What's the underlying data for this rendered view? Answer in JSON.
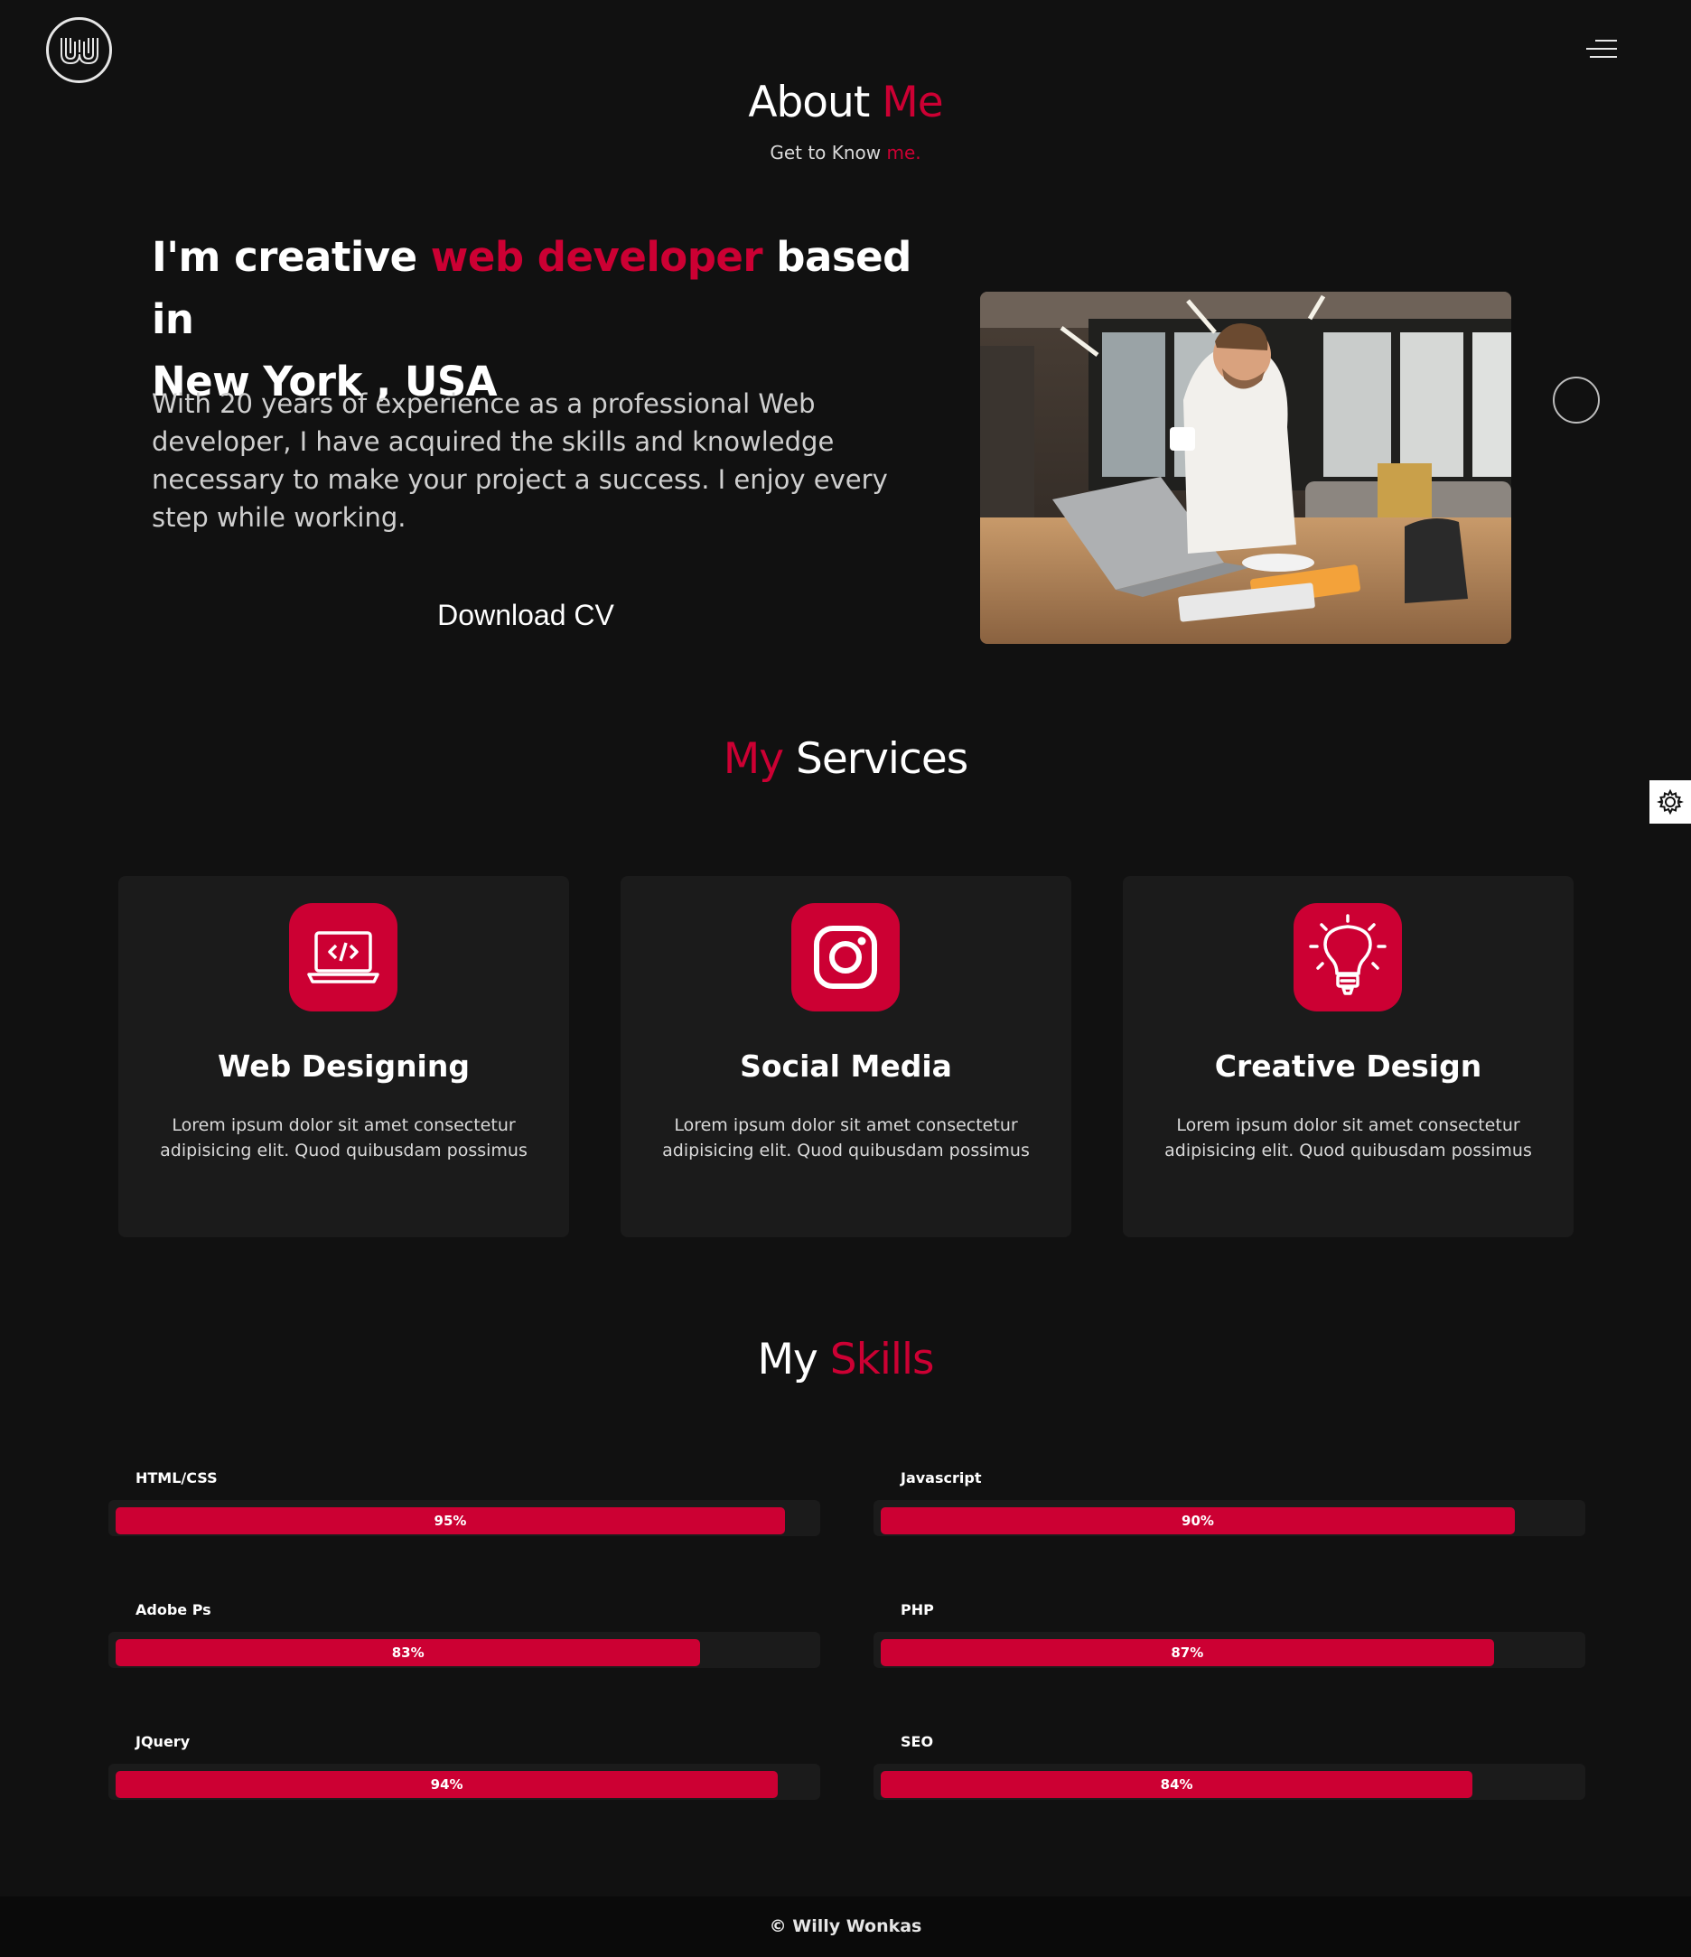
{
  "header": {
    "logo_icon": "w-logo-icon",
    "menu_icon": "hamburger-menu-icon"
  },
  "about": {
    "title_part1": "About ",
    "title_part2": "Me",
    "subtitle_part1": "Get to Know ",
    "subtitle_part2": "me.",
    "headline_part1": "I'm creative ",
    "headline_accent": "web developer",
    "headline_part2": " based in",
    "headline_line2": "New York , USA",
    "lead": "With 20 years of experience as a professional Web developer, I have acquired the skills and knowledge necessary to make your project a success. I enjoy every step while working.",
    "download_label": "Download CV",
    "photo_icon": "portrait-photo"
  },
  "services": {
    "title_part1": "My",
    "title_part2": " Services",
    "items": [
      {
        "name": "Web Designing",
        "desc": "Lorem ipsum dolor sit amet consectetur adipisicing elit. Quod quibusdam possimus",
        "icon": "laptop-code-icon"
      },
      {
        "name": "Social Media",
        "desc": "Lorem ipsum dolor sit amet consectetur adipisicing elit. Quod quibusdam possimus",
        "icon": "instagram-icon"
      },
      {
        "name": "Creative Design",
        "desc": "Lorem ipsum dolor sit amet consectetur adipisicing elit. Quod quibusdam possimus",
        "icon": "lightbulb-icon"
      }
    ]
  },
  "skills": {
    "title_part1": "My ",
    "title_part2": "Skills",
    "items": [
      {
        "name": "HTML/CSS",
        "percent_label": "95%",
        "value": 95
      },
      {
        "name": "Javascript",
        "percent_label": "90%",
        "value": 90
      },
      {
        "name": "Adobe Ps",
        "percent_label": "83%",
        "value": 83
      },
      {
        "name": "PHP",
        "percent_label": "87%",
        "value": 87
      },
      {
        "name": "JQuery",
        "percent_label": "94%",
        "value": 94
      },
      {
        "name": "SEO",
        "percent_label": "84%",
        "value": 84
      }
    ]
  },
  "footer": {
    "text": "© Willy Wonkas"
  },
  "colors": {
    "accent": "#cc0033",
    "background": "#111111",
    "card": "#1b1b1b"
  }
}
